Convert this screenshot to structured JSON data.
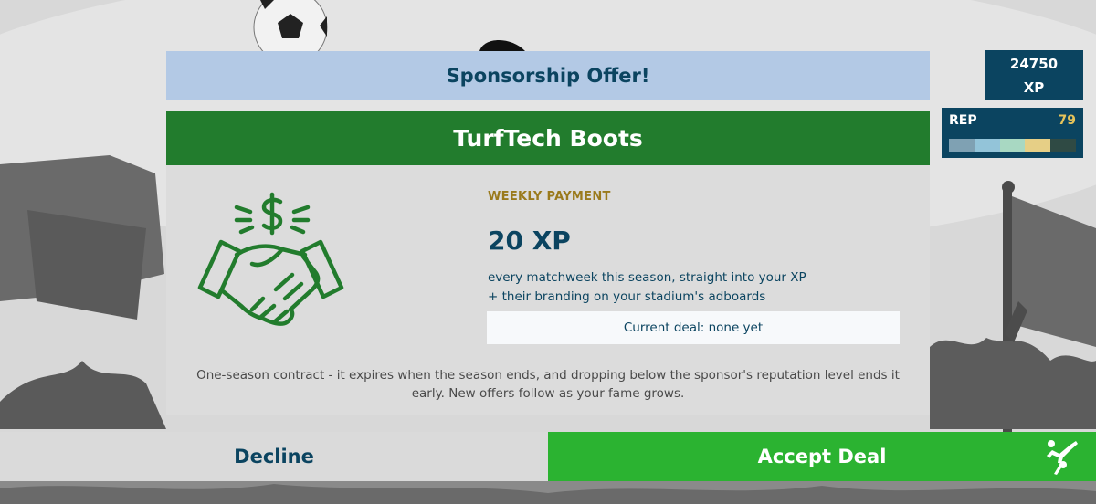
{
  "stats": {
    "xp_value": "24750",
    "xp_label": "XP",
    "rep_label": "REP",
    "rep_value": "79",
    "rep_segments": [
      "#7fa1b3",
      "#93c4d9",
      "#a8d8c2",
      "#e6cf86",
      "#2f4a44"
    ]
  },
  "offer": {
    "header": "Sponsorship Offer!",
    "sponsor_name": "TurfTech Boots",
    "payment_label": "WEEKLY PAYMENT",
    "payment_amount": "20 XP",
    "payment_desc_line1": "every matchweek this season, straight into your XP",
    "payment_desc_line2": "+ their branding on your stadium's adboards",
    "current_deal": "Current deal: none yet",
    "contract_note_line1": "One-season contract - it expires when the season ends, and dropping below the sponsor's reputation level ends it",
    "contract_note_line2": "early. New offers follow as your fame grows.",
    "icon": "handshake-money-icon"
  },
  "actions": {
    "decline_label": "Decline",
    "accept_label": "Accept Deal",
    "accept_icon": "bicycle-kick-icon"
  },
  "colors": {
    "header_bg": "#b3c9e5",
    "sponsor_bg": "#227c2d",
    "accept_bg": "#2bb331",
    "stat_bg": "#0b4460",
    "text_dark": "#0b4460",
    "label_gold": "#9a7a1c"
  }
}
